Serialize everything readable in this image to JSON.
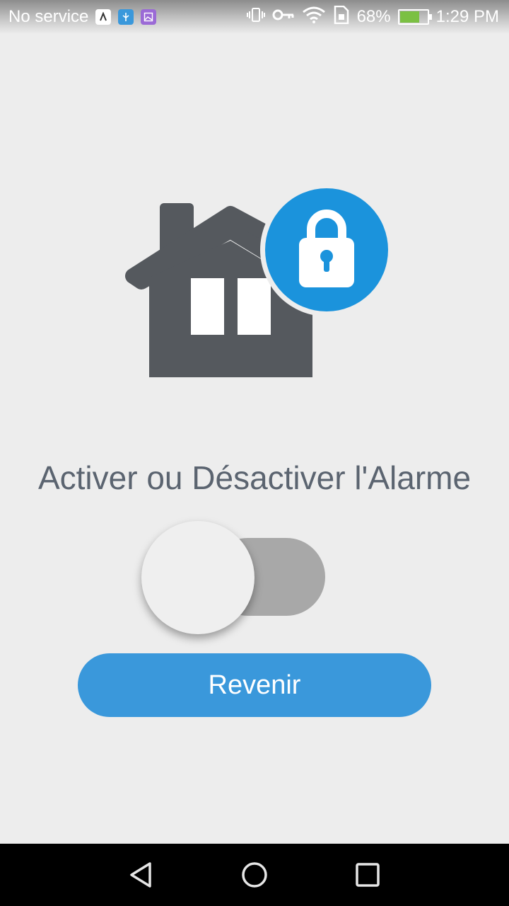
{
  "status_bar": {
    "carrier": "No service",
    "battery_percent": "68%",
    "battery_level": 0.68,
    "time": "1:29 PM",
    "icons": [
      "app-icon-1",
      "usb-icon",
      "image-icon",
      "vibrate-icon",
      "key-icon",
      "wifi-icon",
      "sim-icon",
      "battery-charging-icon"
    ]
  },
  "hero": {
    "icon": "house-lock-icon",
    "colors": {
      "house": "#55595e",
      "lock_badge": "#1b93dc"
    }
  },
  "main": {
    "title": "Activer ou Désactiver l'Alarme",
    "alarm_toggle": {
      "state": "off"
    },
    "back_button_label": "Revenir"
  },
  "nav_bar": {
    "buttons": [
      "back-icon",
      "home-icon",
      "recents-icon"
    ]
  },
  "colors": {
    "background": "#ededed",
    "accent": "#3a98db",
    "title_text": "#5b6470",
    "toggle_track_off": "#a8a8a8"
  }
}
